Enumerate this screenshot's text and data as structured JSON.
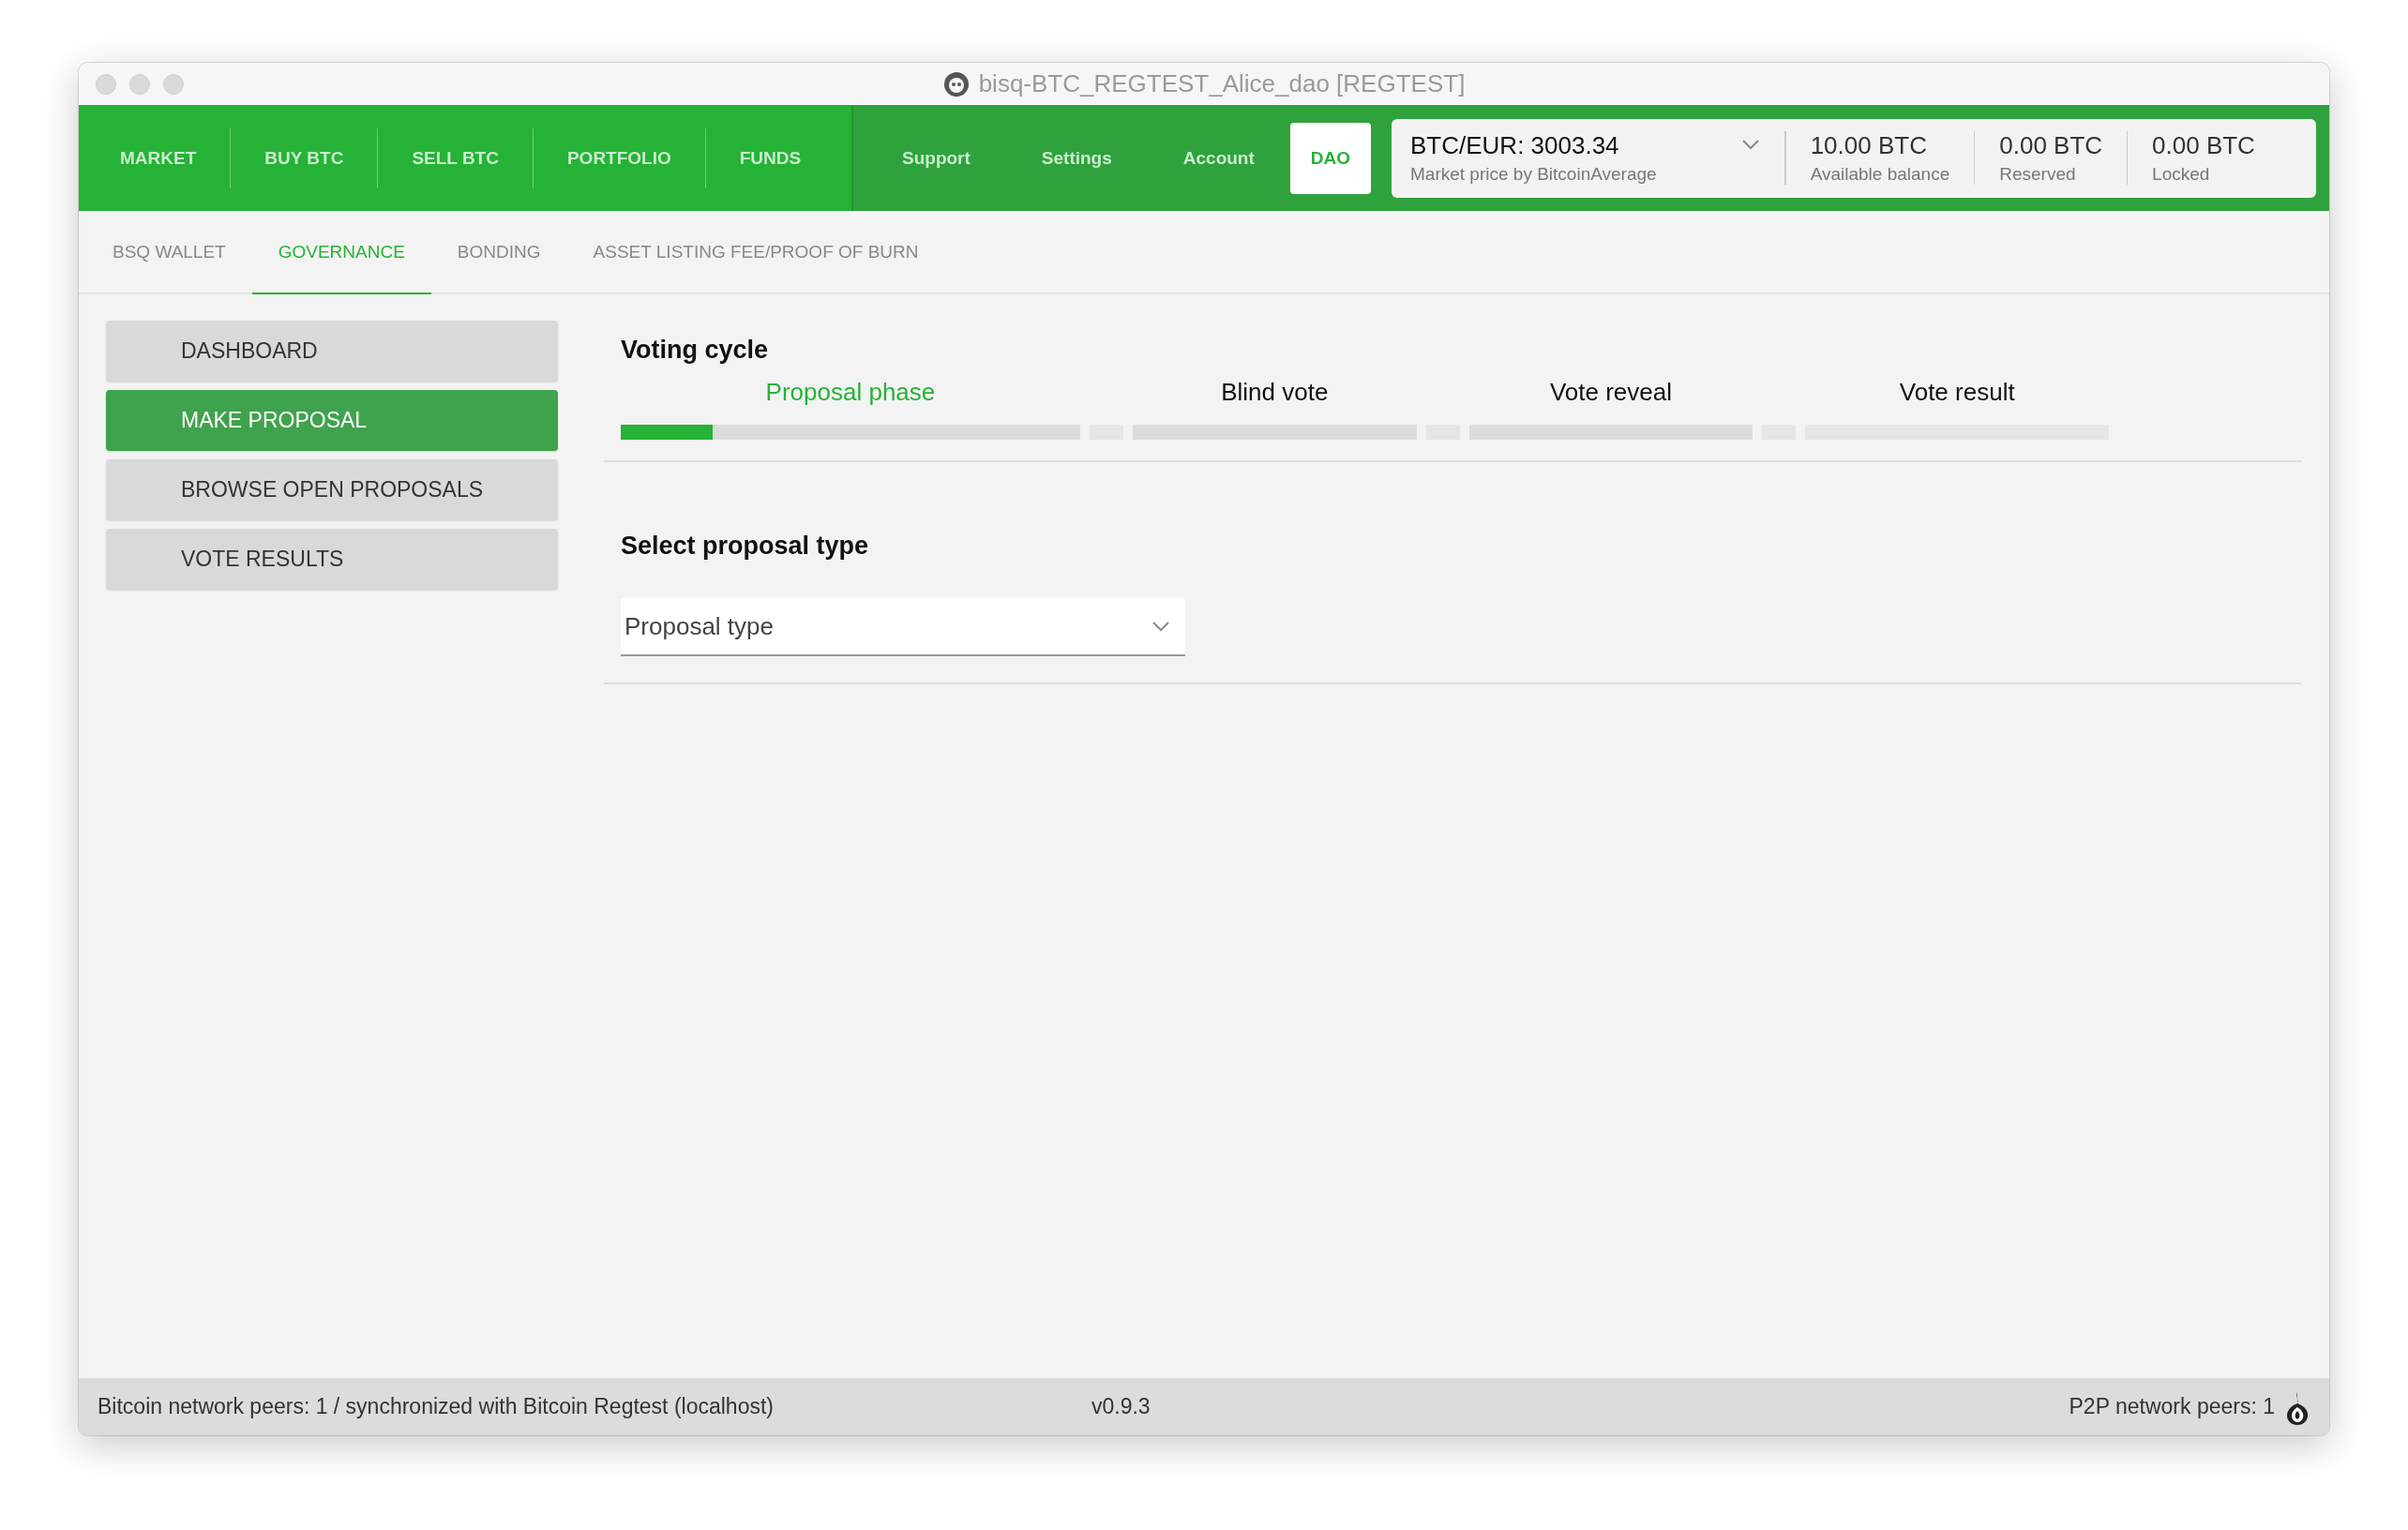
{
  "window": {
    "title": "bisq-BTC_REGTEST_Alice_dao [REGTEST]"
  },
  "nav": {
    "primary": [
      {
        "label": "MARKET",
        "selected": false
      },
      {
        "label": "BUY BTC",
        "selected": false
      },
      {
        "label": "SELL BTC",
        "selected": false
      },
      {
        "label": "PORTFOLIO",
        "selected": false
      },
      {
        "label": "FUNDS",
        "selected": false
      }
    ],
    "secondary": [
      {
        "label": "Support",
        "selected": false
      },
      {
        "label": "Settings",
        "selected": false
      },
      {
        "label": "Account",
        "selected": false
      },
      {
        "label": "DAO",
        "selected": true
      }
    ]
  },
  "market": {
    "price": "BTC/EUR: 3003.34",
    "caption": "Market price by BitcoinAverage"
  },
  "balances": [
    {
      "value": "10.00 BTC",
      "caption": "Available balance"
    },
    {
      "value": "0.00 BTC",
      "caption": "Reserved"
    },
    {
      "value": "0.00 BTC",
      "caption": "Locked"
    }
  ],
  "subtabs": [
    {
      "label": "BSQ WALLET",
      "selected": false
    },
    {
      "label": "GOVERNANCE",
      "selected": true
    },
    {
      "label": "BONDING",
      "selected": false
    },
    {
      "label": "ASSET LISTING FEE/PROOF OF BURN",
      "selected": false
    }
  ],
  "sidebar": {
    "items": [
      {
        "label": "DASHBOARD",
        "selected": false
      },
      {
        "label": "MAKE PROPOSAL",
        "selected": true
      },
      {
        "label": "BROWSE OPEN PROPOSALS",
        "selected": false
      },
      {
        "label": "VOTE RESULTS",
        "selected": false
      }
    ]
  },
  "voting_cycle": {
    "title": "Voting cycle",
    "timeline": [
      {
        "kind": "phase",
        "label": "Proposal phase",
        "selected": true,
        "level": 0.2
      },
      {
        "kind": "break"
      },
      {
        "kind": "phase",
        "label": "Blind vote",
        "selected": false
      },
      {
        "kind": "break"
      },
      {
        "kind": "phase",
        "label": "Vote reveal",
        "selected": false
      },
      {
        "kind": "break"
      },
      {
        "kind": "result",
        "label": "Vote result",
        "selected": false
      }
    ]
  },
  "proposal": {
    "title": "Select proposal type",
    "select": {
      "placeholder": "Proposal type"
    }
  },
  "status_bar": {
    "left": "Bitcoin network peers: 1 / synchronized with Bitcoin Regtest (localhost)",
    "center": "v0.9.3",
    "right": "P2P network peers: 1"
  }
}
